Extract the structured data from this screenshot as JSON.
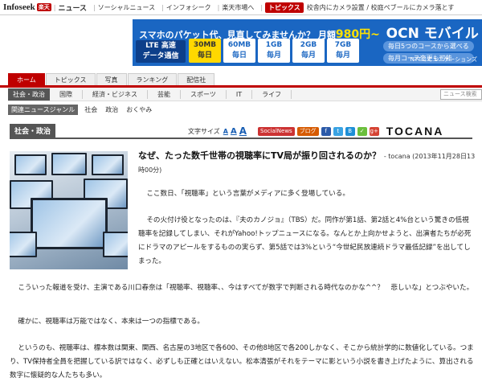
{
  "topbar": {
    "logo_main": "Infoseek",
    "logo_rakuten": "楽天",
    "news_label": "ニュース",
    "links": [
      "ソーシャルニュース",
      "インフォシーク",
      "楽天市場へ"
    ],
    "topics_badge": "トピックス",
    "topics_text": "校舎内にカメラ設置 / 校庭ペブールにカメラ落とす"
  },
  "ad": {
    "headline": "スマホのパケット代、見直してみませんか？",
    "price_label": "月額",
    "price": "980円~",
    "brand": "OCN モバイル ONE",
    "lte": [
      "LTE 高速",
      "データ通信"
    ],
    "plans": [
      {
        "size": "30MB",
        "unit": "毎日"
      },
      {
        "size": "60MB",
        "unit": "毎日"
      },
      {
        "size": "1GB",
        "unit": "毎月"
      },
      {
        "size": "2GB",
        "unit": "毎月"
      },
      {
        "size": "7GB",
        "unit": "毎月"
      }
    ],
    "pills": [
      "毎日5つのコースから選べる",
      "毎月コース変更も可能"
    ],
    "ntt": "NTTコミュニケーションズ"
  },
  "global_nav": [
    "ホーム",
    "トピックス",
    "写真",
    "ランキング",
    "配信社"
  ],
  "sub_nav": [
    "社会・政治",
    "国際",
    "経済・ビジネス",
    "芸能",
    "スポーツ",
    "IT",
    "ライフ"
  ],
  "search": {
    "placeholder": "ニュース検索"
  },
  "breadcrumb": {
    "label": "関連ニュースジャンル",
    "items": [
      "社会",
      "政治",
      "おくやみ"
    ]
  },
  "section": {
    "title": "社会・政治"
  },
  "tools": {
    "font_size_label": "文字サイズ",
    "font_sizes": [
      "A",
      "A",
      "A"
    ],
    "social_news": "SocialNews",
    "blog": "ブログ",
    "brand": "TOCANA"
  },
  "article": {
    "headline": "なぜ、たった数千世帯の視聴率にTV局が振り回されるのか？",
    "meta": "- tocana (2013年11月28日13時00分)",
    "paragraphs": [
      "ここ数日、「視聴率」という言葉がメディアに多く登場している。",
      "その火付け役となったのは、『夫のカノジョ』（TBS）だ。同作が第1話、第2話と4%台という驚きの低視聴率を記録してしまい、それがYahoo!トップニュースになる。なんとか上向かせようと、出演者たちが必死にドラマのアピールをするものの実らず、第5話では3%という“今世紀民放連続ドラマ最低記録”を出してしまった。",
      "こういった報道を受け、主演である川口春奈は「視聴率、視聴率、、今はすべてが数字で判断される時代なのかな^^？　悲しいな」とつぶやいた。",
      "確かに、視聴率は万能ではなく、本来は一つの指標である。",
      "というのも、視聴率は、標本数は関東、関西、名古屋の3地区で各600、その他8地区で各200しかなく、そこから統計学的に数値化している。つまり、TV保持者全員を把握している訳ではなく、必ずしも正確とはいえない。松本清張がそれをテーマに影という小説を書き上げたように、算出される数字に懐疑的な人たちも多い。"
    ]
  },
  "colors": {
    "brand_red": "#bf0000",
    "ad_blue": "#1a66c2"
  }
}
